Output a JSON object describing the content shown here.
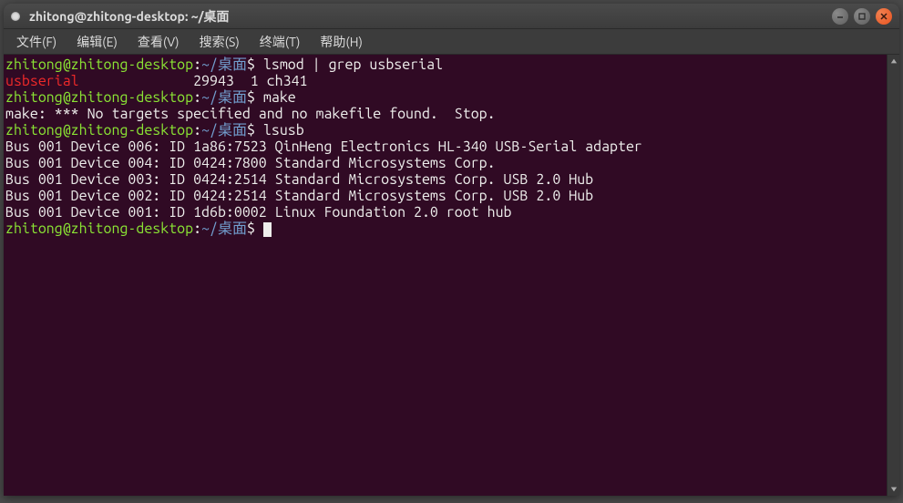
{
  "window": {
    "title": "zhitong@zhitong-desktop: ~/桌面"
  },
  "menu": {
    "file": "文件(F)",
    "edit": "编辑(E)",
    "view": "查看(V)",
    "search": "搜索(S)",
    "terminal": "终端(T)",
    "help": "帮助(H)"
  },
  "prompt": {
    "user_host": "zhitong@zhitong-desktop",
    "colon": ":",
    "path": "~/桌面",
    "dollar": "$"
  },
  "lines": {
    "cmd1": " lsmod | grep usbserial",
    "out1_match": "usbserial",
    "out1_rest": "              29943  1 ch341",
    "cmd2": " make",
    "out2": "make: *** No targets specified and no makefile found.  Stop.",
    "cmd3": " lsusb",
    "out3_1": "Bus 001 Device 006: ID 1a86:7523 QinHeng Electronics HL-340 USB-Serial adapter",
    "out3_2": "Bus 001 Device 004: ID 0424:7800 Standard Microsystems Corp.",
    "out3_3": "Bus 001 Device 003: ID 0424:2514 Standard Microsystems Corp. USB 2.0 Hub",
    "out3_4": "Bus 001 Device 002: ID 0424:2514 Standard Microsystems Corp. USB 2.0 Hub",
    "out3_5": "Bus 001 Device 001: ID 1d6b:0002 Linux Foundation 2.0 root hub",
    "cmd4": " "
  }
}
